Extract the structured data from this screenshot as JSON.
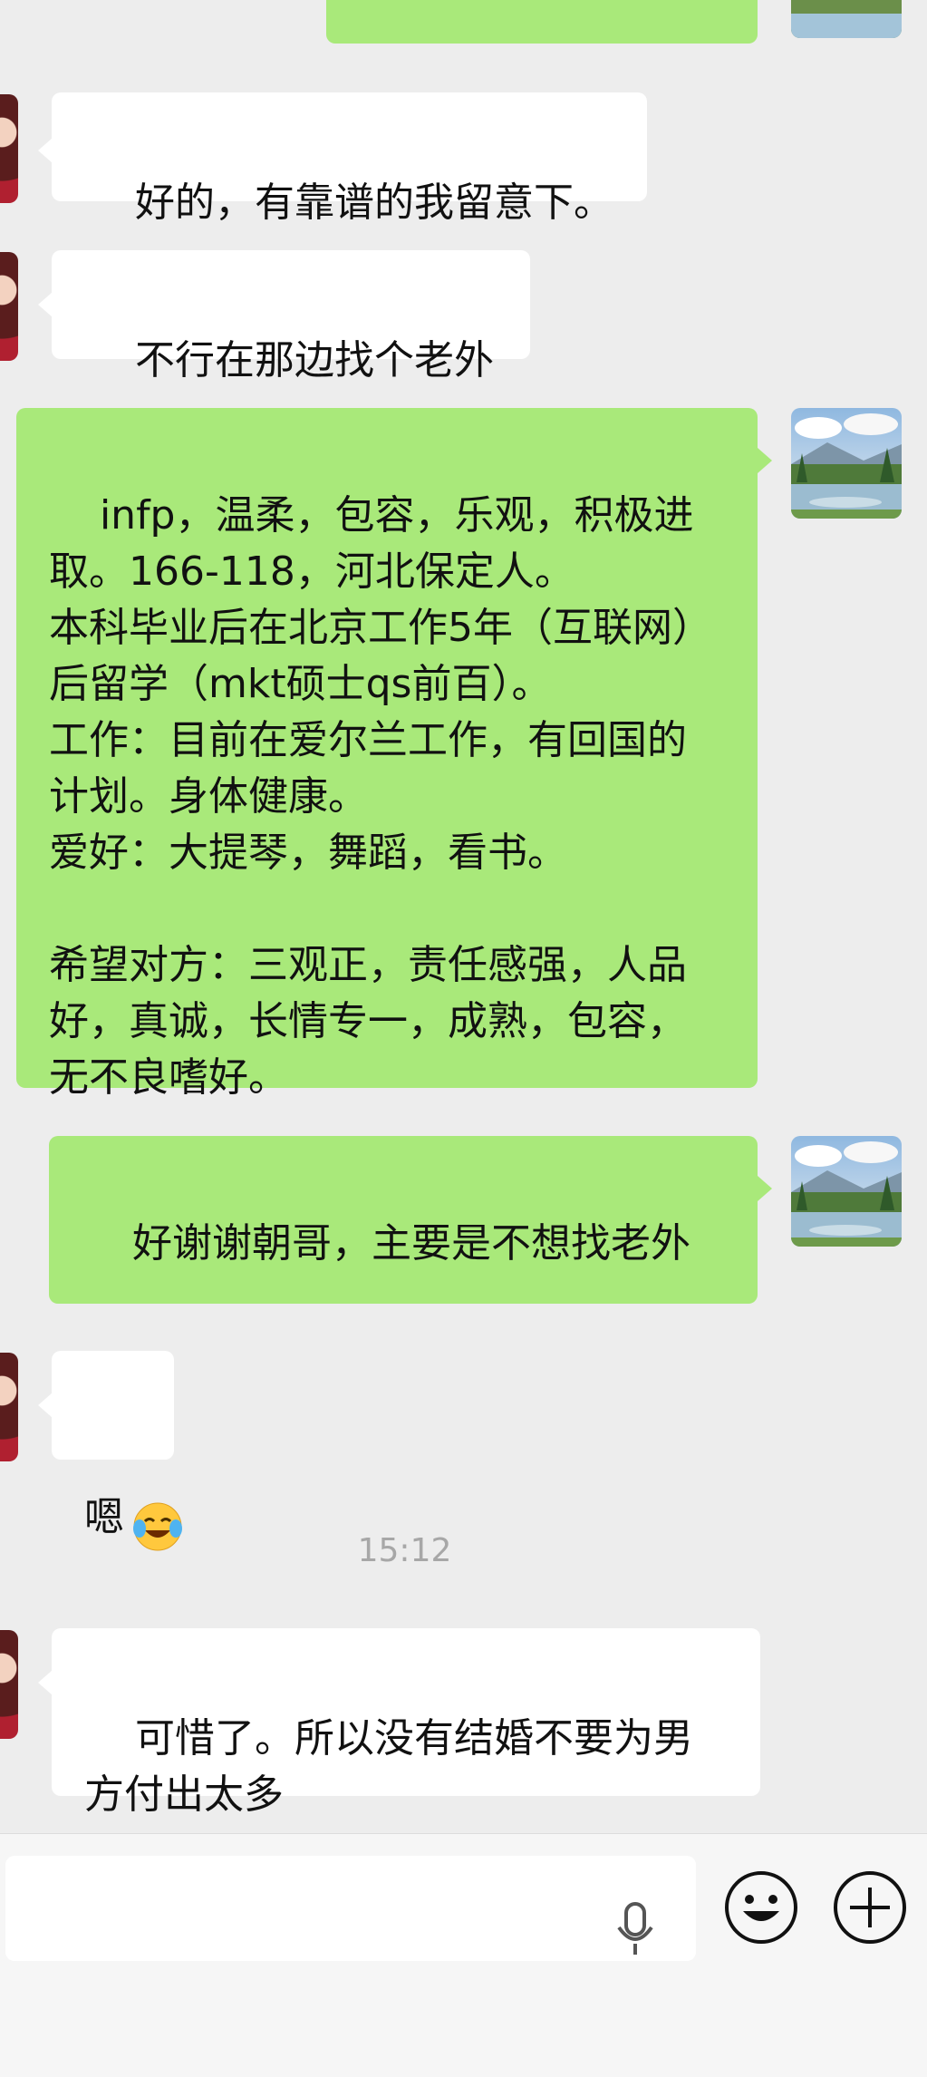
{
  "chat": {
    "messages": [
      {
        "id": "m0",
        "side": "out",
        "text": ""
      },
      {
        "id": "m1",
        "side": "in",
        "text": "好的，有靠谱的我留意下。"
      },
      {
        "id": "m2",
        "side": "in",
        "text": "不行在那边找个老外"
      },
      {
        "id": "m3",
        "side": "out",
        "text": "infp，温柔，包容，乐观，积极进取。166-118，河北保定人。\n本科毕业后在北京工作5年（互联网）后留学（mkt硕士qs前百）。\n工作：目前在爱尔兰工作，有回国的计划。身体健康。\n爱好：大提琴，舞蹈，看书。\n\n希望对方：三观正，责任感强，人品好，真诚，长情专一，成熟，包容，无不良嗜好。"
      },
      {
        "id": "m4",
        "side": "out",
        "text": "好谢谢朝哥，主要是不想找老外",
        "emoji": "laughing-tears-emoji"
      },
      {
        "id": "m5",
        "side": "in",
        "text": "嗯"
      },
      {
        "id": "m6",
        "side": "in",
        "text": "可惜了。所以没有结婚不要为男方付出太多"
      }
    ],
    "timestamp": "15:12"
  },
  "input_bar": {
    "placeholder": "",
    "icons": [
      "microphone-icon",
      "emoji-smile-icon",
      "plus-icon"
    ]
  },
  "colors": {
    "background": "#ededed",
    "outgoing_bubble": "#a9e97a",
    "incoming_bubble": "#ffffff",
    "timestamp": "#a7a7a7"
  }
}
